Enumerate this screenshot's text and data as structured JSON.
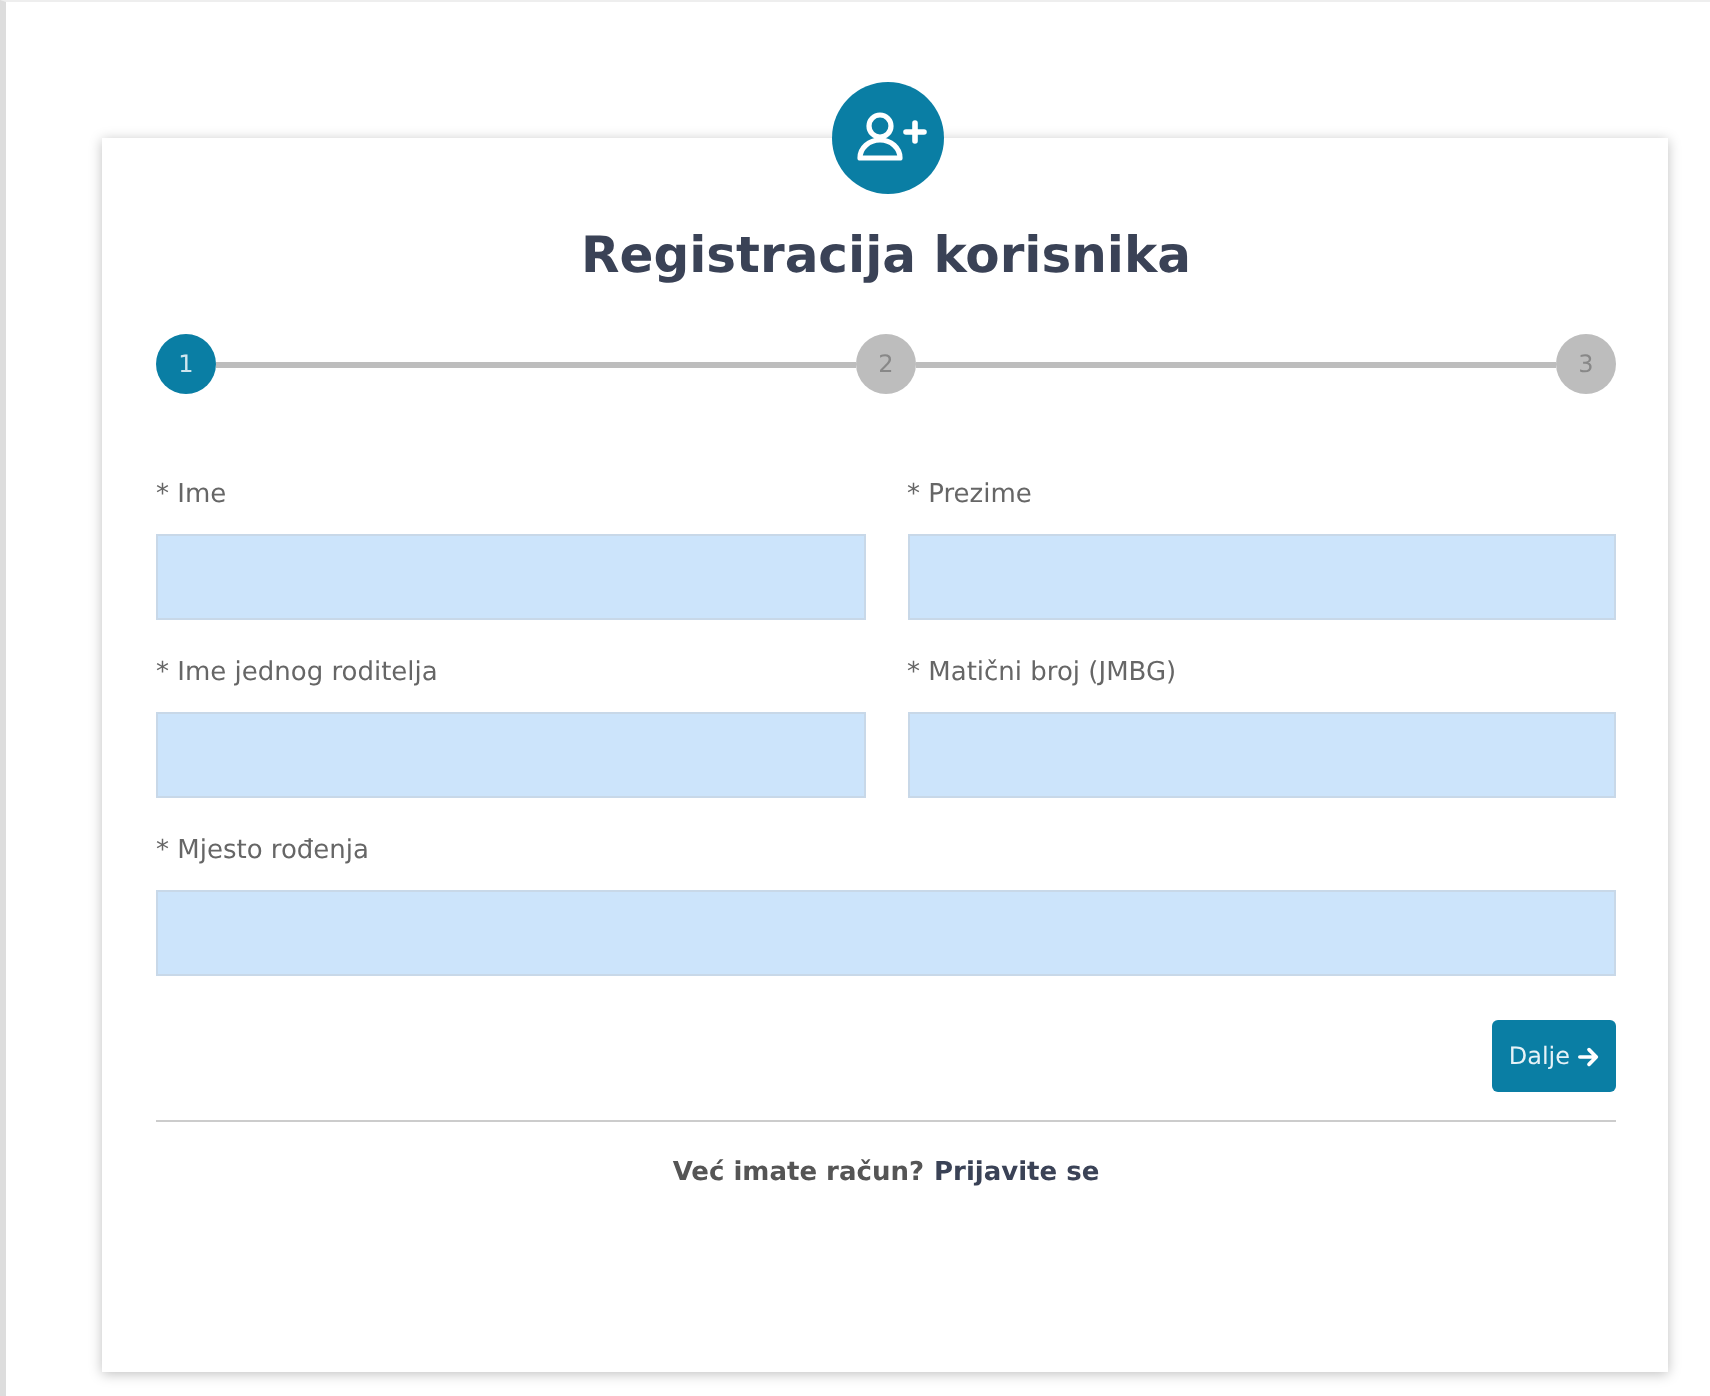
{
  "title": "Registracija korisnika",
  "steps": [
    {
      "label": "1",
      "selected": true
    },
    {
      "label": "2",
      "selected": false
    },
    {
      "label": "3",
      "selected": false
    }
  ],
  "fields": [
    {
      "label": "* Ime",
      "kind": "half"
    },
    {
      "label": "* Prezime",
      "kind": "half"
    },
    {
      "label": "* Ime jednog roditelja",
      "kind": "half"
    },
    {
      "label": "* Matični broj (JMBG)",
      "kind": "half"
    },
    {
      "label": "* Mjesto rođenja",
      "kind": "full"
    }
  ],
  "next_button": "Dalje",
  "footer": {
    "text": "Već imate račun?",
    "link": "Prijavite se"
  }
}
